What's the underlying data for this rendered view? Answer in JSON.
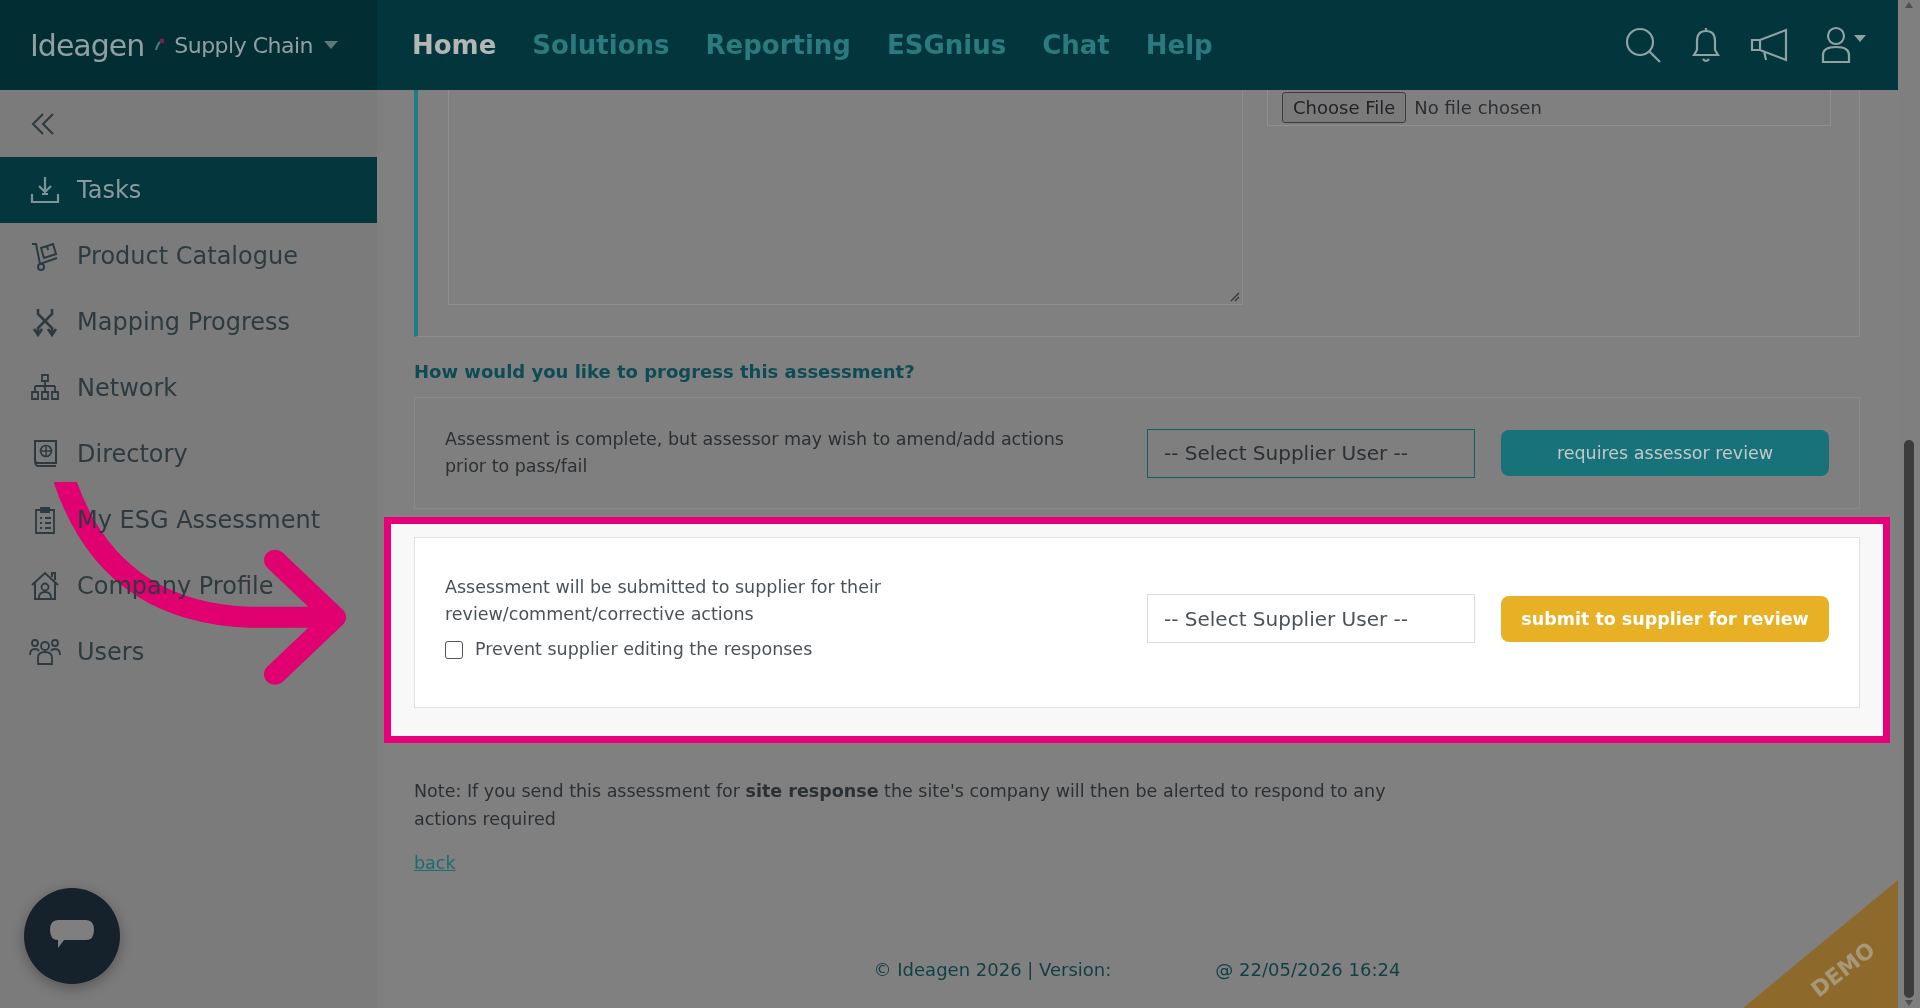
{
  "header": {
    "logo": "Ideagen",
    "product": "Supply Chain",
    "nav": [
      {
        "label": "Home",
        "selected": true
      },
      {
        "label": "Solutions",
        "selected": false
      },
      {
        "label": "Reporting",
        "selected": false
      },
      {
        "label": "ESGnius",
        "selected": false
      },
      {
        "label": "Chat",
        "selected": false
      },
      {
        "label": "Help",
        "selected": false
      }
    ]
  },
  "sidebar": {
    "items": [
      {
        "label": "Tasks",
        "selected": true
      },
      {
        "label": "Product Catalogue",
        "selected": false
      },
      {
        "label": "Mapping Progress",
        "selected": false
      },
      {
        "label": "Network",
        "selected": false
      },
      {
        "label": "Directory",
        "selected": false
      },
      {
        "label": "My ESG Assessment",
        "selected": false
      },
      {
        "label": "Company Profile",
        "selected": false
      },
      {
        "label": "Users",
        "selected": false
      }
    ]
  },
  "upload": {
    "button": "Choose File",
    "status": "No file chosen"
  },
  "progress": {
    "heading": "How would you like to progress this assessment?",
    "options": [
      {
        "kind": "assessor",
        "highlighted": false,
        "description": "Assessment is complete, but assessor may wish to amend/add actions prior to pass/fail",
        "select_placeholder": "-- Select Supplier User --",
        "button": "requires assessor review"
      },
      {
        "kind": "supplier",
        "highlighted": true,
        "description": "Assessment will be submitted to supplier for their review/comment/corrective actions",
        "checkbox": {
          "label": "Prevent supplier editing the responses",
          "checked": false
        },
        "select_placeholder": "-- Select Supplier User --",
        "button": "submit to supplier for review"
      }
    ]
  },
  "note": "Note: If you send this assessment for **site response** the site's company will then be alerted to respond to any actions required",
  "back_link": "back",
  "footer": {
    "copyright": "© Ideagen 2026 | Version:",
    "timestamp": "@ 22/05/2026 16:24"
  },
  "badge": "DEMO"
}
